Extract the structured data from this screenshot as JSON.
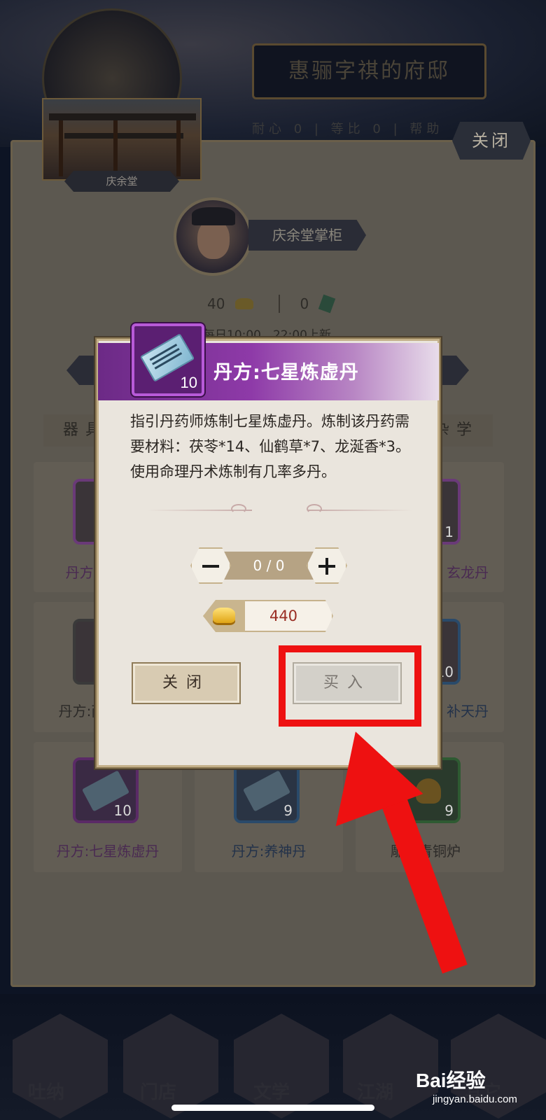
{
  "background": {
    "building_title": "惠骊字祺的府邸",
    "building_stats": "耐心 0 | 等比 0 | 帮助",
    "top_close_label": "关闭",
    "shop_name": "庆余堂",
    "npc_title": "庆余堂掌柜",
    "gold_amount": "40",
    "jade_amount": "0",
    "refresh_note": "每日10:00、22:00上新",
    "tabs": [
      "器具",
      "杂学"
    ],
    "grid": [
      {
        "label": "丹方:",
        "count": "",
        "border": "#6a3a78"
      },
      {
        "label": "玄龙丹",
        "count": "1",
        "border": "#6a3a78"
      },
      {
        "label": "丹方:两",
        "count": "",
        "border": "#3a3a3a"
      },
      {
        "label": "补天丹",
        "count": "10",
        "border": "#2a4a6a"
      },
      {
        "label": "丹方:七星炼虚丹",
        "count": "10",
        "border": "#6a3a78"
      },
      {
        "label": "丹方:养神丹",
        "count": "9",
        "border": "#2a4a6a"
      },
      {
        "label": "雕花青铜炉",
        "count": "9",
        "border": "#2e5a32"
      }
    ],
    "bottom_nav": [
      "吐纳",
      "门店",
      "文学",
      "江湖",
      "其它"
    ]
  },
  "modal": {
    "item_title": "丹方:七星炼虚丹",
    "item_count": "10",
    "description": "指引丹药师炼制七星炼虚丹。炼制该丹药需要材料：茯苓*14、仙鹤草*7、龙涎香*3。使用命理丹术炼制有几率多丹。",
    "quantity": "0 / 0",
    "price": "440",
    "close_label": "关闭",
    "buy_label": "买入"
  },
  "annotation": {
    "highlight_color": "#ee1111"
  },
  "watermark": {
    "brand": "Bai经验",
    "url": "jingyan.baidu.com"
  },
  "colors": {
    "modal_bg": "#eae5dd",
    "header_purple": "#8e3aa8",
    "price_red": "#9a2e24"
  }
}
